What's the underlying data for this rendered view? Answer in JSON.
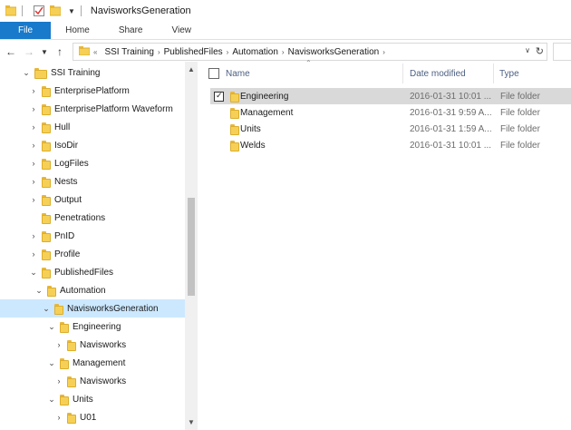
{
  "window": {
    "title": "NavisworksGeneration"
  },
  "ribbon": {
    "tabs": [
      "File",
      "Home",
      "Share",
      "View"
    ]
  },
  "address": {
    "overflow": "«",
    "crumbs": [
      "SSI Training",
      "PublishedFiles",
      "Automation",
      "NavisworksGeneration"
    ]
  },
  "nav_tree": [
    {
      "label": "SSI Training",
      "arrow": "down",
      "folder": true
    },
    {
      "label": "EnterprisePlatform",
      "arrow": "right",
      "folder": true
    },
    {
      "label": "EnterprisePlatform Waveform",
      "arrow": "right",
      "folder": true
    },
    {
      "label": "Hull",
      "arrow": "right",
      "folder": true
    },
    {
      "label": "IsoDir",
      "arrow": "right",
      "folder": true
    },
    {
      "label": "LogFiles",
      "arrow": "right",
      "folder": true
    },
    {
      "label": "Nests",
      "arrow": "right",
      "folder": true
    },
    {
      "label": "Output",
      "arrow": "right",
      "folder": true
    },
    {
      "label": "Penetrations",
      "arrow": "none",
      "folder": true
    },
    {
      "label": "PnID",
      "arrow": "right",
      "folder": true
    },
    {
      "label": "Profile",
      "arrow": "right",
      "folder": true
    },
    {
      "label": "PublishedFiles",
      "arrow": "down",
      "folder": true
    },
    {
      "label": "Automation",
      "arrow": "down",
      "folder": true
    },
    {
      "label": "NavisworksGeneration",
      "arrow": "down",
      "folder": true,
      "selected": true
    },
    {
      "label": "Engineering",
      "arrow": "down",
      "folder": true
    },
    {
      "label": "Navisworks",
      "arrow": "right",
      "folder": true
    },
    {
      "label": "Management",
      "arrow": "down",
      "folder": true
    },
    {
      "label": "Navisworks",
      "arrow": "right",
      "folder": true
    },
    {
      "label": "Units",
      "arrow": "down",
      "folder": true
    },
    {
      "label": "U01",
      "arrow": "right",
      "folder": true
    }
  ],
  "columns": {
    "name": "Name",
    "date": "Date modified",
    "type": "Type"
  },
  "files": [
    {
      "name": "Engineering",
      "date": "2016-01-31 10:01 ...",
      "type": "File folder",
      "selected": true
    },
    {
      "name": "Management",
      "date": "2016-01-31 9:59 A...",
      "type": "File folder"
    },
    {
      "name": "Units",
      "date": "2016-01-31 1:59 A...",
      "type": "File folder"
    },
    {
      "name": "Welds",
      "date": "2016-01-31 10:01 ...",
      "type": "File folder"
    }
  ],
  "colors": {
    "accent": "#1979ca",
    "selection": "#cce8ff",
    "row_selected": "#d9d9d9"
  }
}
